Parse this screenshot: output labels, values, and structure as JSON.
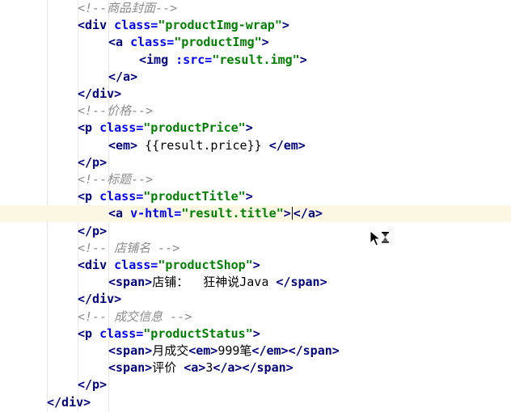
{
  "editor": {
    "lines": [
      {
        "indent": 2,
        "segments": [
          {
            "t": "com",
            "s": "<!--商品封面-->"
          }
        ]
      },
      {
        "indent": 2,
        "segments": [
          {
            "t": "tag",
            "s": "<div "
          },
          {
            "t": "attr",
            "s": "class="
          },
          {
            "t": "str",
            "s": "\"productImg-wrap\""
          },
          {
            "t": "tag",
            "s": ">"
          }
        ]
      },
      {
        "indent": 3,
        "segments": [
          {
            "t": "tag",
            "s": "<a "
          },
          {
            "t": "attr",
            "s": "class="
          },
          {
            "t": "str",
            "s": "\"productImg\""
          },
          {
            "t": "tag",
            "s": ">"
          }
        ]
      },
      {
        "indent": 4,
        "segments": [
          {
            "t": "tag",
            "s": "<img "
          },
          {
            "t": "attr",
            "s": ":src="
          },
          {
            "t": "str",
            "s": "\"result.img\""
          },
          {
            "t": "tag",
            "s": ">"
          }
        ]
      },
      {
        "indent": 3,
        "segments": [
          {
            "t": "tag",
            "s": "</a>"
          }
        ]
      },
      {
        "indent": 2,
        "segments": [
          {
            "t": "tag",
            "s": "</div>"
          }
        ]
      },
      {
        "indent": 2,
        "segments": [
          {
            "t": "com",
            "s": "<!--价格-->"
          }
        ]
      },
      {
        "indent": 2,
        "segments": [
          {
            "t": "tag",
            "s": "<p "
          },
          {
            "t": "attr",
            "s": "class="
          },
          {
            "t": "str",
            "s": "\"productPrice\""
          },
          {
            "t": "tag",
            "s": ">"
          }
        ]
      },
      {
        "indent": 3,
        "segments": [
          {
            "t": "tag",
            "s": "<em>"
          },
          {
            "t": "txt",
            "s": " {{result.price}} "
          },
          {
            "t": "tag",
            "s": "</em>"
          }
        ]
      },
      {
        "indent": 2,
        "segments": [
          {
            "t": "tag",
            "s": "</p>"
          }
        ]
      },
      {
        "indent": 2,
        "segments": [
          {
            "t": "com",
            "s": "<!--标题-->"
          }
        ]
      },
      {
        "indent": 2,
        "segments": [
          {
            "t": "tag",
            "s": "<p "
          },
          {
            "t": "attr",
            "s": "class="
          },
          {
            "t": "str",
            "s": "\"productTitle\""
          },
          {
            "t": "tag",
            "s": ">"
          }
        ]
      },
      {
        "indent": 3,
        "current": true,
        "segments": [
          {
            "t": "tag",
            "s": "<a "
          },
          {
            "t": "attr",
            "s": "v-html="
          },
          {
            "t": "str",
            "s": "\"result.title\""
          },
          {
            "t": "tag",
            "s": ">"
          },
          {
            "t": "caret",
            "s": ""
          },
          {
            "t": "tag",
            "s": "</a>"
          }
        ]
      },
      {
        "indent": 2,
        "segments": [
          {
            "t": "tag",
            "s": "</p>"
          }
        ]
      },
      {
        "indent": 2,
        "segments": [
          {
            "t": "com",
            "s": "<!-- 店铺名 -->"
          }
        ]
      },
      {
        "indent": 2,
        "segments": [
          {
            "t": "tag",
            "s": "<div "
          },
          {
            "t": "attr",
            "s": "class="
          },
          {
            "t": "str",
            "s": "\"productShop\""
          },
          {
            "t": "tag",
            "s": ">"
          }
        ]
      },
      {
        "indent": 3,
        "segments": [
          {
            "t": "tag",
            "s": "<span>"
          },
          {
            "t": "txt",
            "s": "店铺：  狂神说Java "
          },
          {
            "t": "tag",
            "s": "</span>"
          }
        ]
      },
      {
        "indent": 2,
        "segments": [
          {
            "t": "tag",
            "s": "</div>"
          }
        ]
      },
      {
        "indent": 2,
        "segments": [
          {
            "t": "com",
            "s": "<!-- 成交信息 -->"
          }
        ]
      },
      {
        "indent": 2,
        "segments": [
          {
            "t": "tag",
            "s": "<p "
          },
          {
            "t": "attr",
            "s": "class="
          },
          {
            "t": "str",
            "s": "\"productStatus\""
          },
          {
            "t": "tag",
            "s": ">"
          }
        ]
      },
      {
        "indent": 3,
        "segments": [
          {
            "t": "tag",
            "s": "<span>"
          },
          {
            "t": "txt",
            "s": "月成交"
          },
          {
            "t": "tag",
            "s": "<em>"
          },
          {
            "t": "txt",
            "s": "999笔"
          },
          {
            "t": "tag",
            "s": "</em></span>"
          }
        ]
      },
      {
        "indent": 3,
        "segments": [
          {
            "t": "tag",
            "s": "<span>"
          },
          {
            "t": "txt",
            "s": "评价 "
          },
          {
            "t": "tag",
            "s": "<a>"
          },
          {
            "t": "txt",
            "s": "3"
          },
          {
            "t": "tag",
            "s": "</a></span>"
          }
        ]
      },
      {
        "indent": 2,
        "segments": [
          {
            "t": "tag",
            "s": "</p>"
          }
        ]
      },
      {
        "indent": 1,
        "segments": [
          {
            "t": "tag",
            "s": "</div>"
          }
        ]
      }
    ]
  },
  "cursor_icon": "busy-pointer-icon"
}
